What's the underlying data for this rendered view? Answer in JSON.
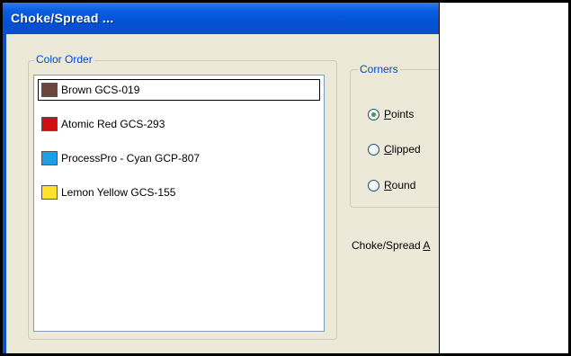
{
  "window": {
    "title": "Choke/Spread ..."
  },
  "color_order": {
    "legend": "Color Order",
    "items": [
      {
        "label": "Brown GCS-019",
        "color": "#6b463d",
        "selected": true
      },
      {
        "label": "Atomic Red GCS-293",
        "color": "#d01010",
        "selected": false
      },
      {
        "label": "ProcessPro - Cyan GCP-807",
        "color": "#1e9ee6",
        "selected": false
      },
      {
        "label": "Lemon Yellow GCS-155",
        "color": "#ffe02a",
        "selected": false
      }
    ]
  },
  "corners": {
    "legend": "Corners",
    "options": [
      {
        "accel": "P",
        "rest": "oints",
        "checked": true
      },
      {
        "accel": "C",
        "rest": "lipped",
        "checked": false
      },
      {
        "accel": "R",
        "rest": "ound",
        "checked": false
      }
    ]
  },
  "choke_spread": {
    "label_prefix": "Choke/Spread ",
    "label_accel": "A",
    "label_rest": ""
  }
}
